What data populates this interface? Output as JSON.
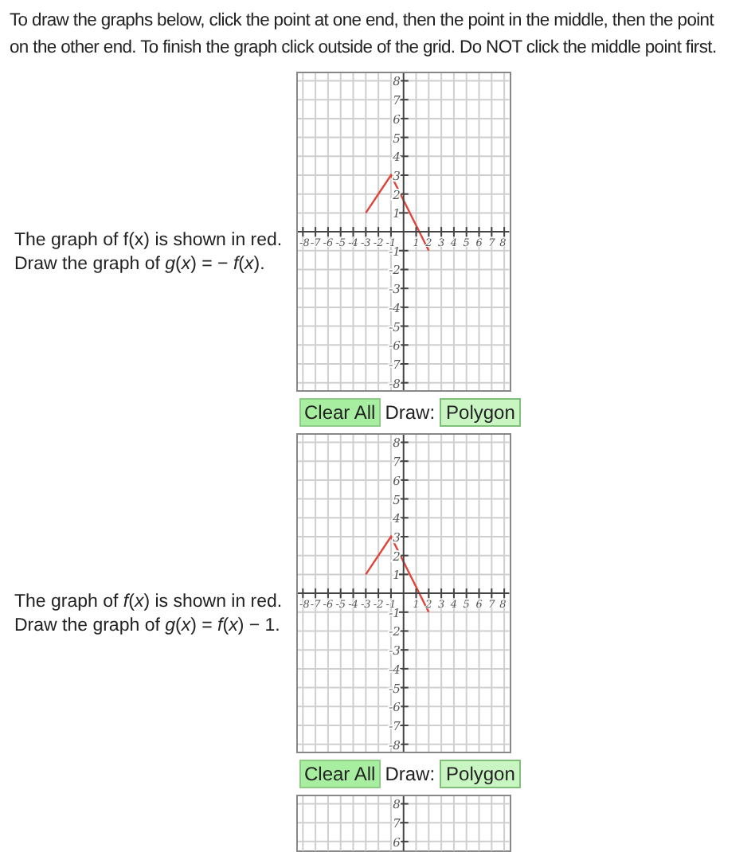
{
  "instructions": "To draw the graphs below, click the point at one end, then the point in the middle, then the point on the other end. To finish the graph click outside of the grid. Do NOT click the middle point first.",
  "problems": [
    {
      "statement": [
        "The graph of f(x) is shown in red.",
        "Draw the graph of *g*(*x*) = − *f*(*x*)."
      ],
      "chart_data": {
        "type": "line",
        "grid": true,
        "x": [
          -3,
          -1,
          2
        ],
        "series": [
          {
            "color": "#e0443a",
            "values": [
              1,
              3,
              -1
            ]
          }
        ],
        "xlim": [
          -8.4,
          8.4
        ],
        "ylim": [
          -8.4,
          8.4
        ],
        "xticks": [
          -8,
          -7,
          -6,
          -5,
          -4,
          -3,
          -2,
          -1,
          1,
          2,
          3,
          4,
          5,
          6,
          7,
          8
        ],
        "yticks": [
          -8,
          -7,
          -6,
          -5,
          -4,
          -3,
          -2,
          -1,
          1,
          2,
          3,
          4,
          5,
          6,
          7,
          8
        ]
      },
      "controls": {
        "clear": "Clear All",
        "draw_label": "Draw:",
        "draw_mode": "Polygon"
      }
    },
    {
      "statement": [
        "The graph of *f*(*x*) is shown in red.",
        "Draw the graph of *g*(*x*) = *f*(*x*) − 1."
      ],
      "chart_data": {
        "type": "line",
        "grid": true,
        "x": [
          -3,
          -1,
          2
        ],
        "series": [
          {
            "color": "#e0443a",
            "values": [
              1,
              3,
              -1
            ]
          }
        ],
        "xlim": [
          -8.4,
          8.4
        ],
        "ylim": [
          -8.4,
          8.4
        ],
        "xticks": [
          -8,
          -7,
          -6,
          -5,
          -4,
          -3,
          -2,
          -1,
          1,
          2,
          3,
          4,
          5,
          6,
          7,
          8
        ],
        "yticks": [
          -8,
          -7,
          -6,
          -5,
          -4,
          -3,
          -2,
          -1,
          1,
          2,
          3,
          4,
          5,
          6,
          7,
          8
        ]
      },
      "controls": {
        "clear": "Clear All",
        "draw_label": "Draw:",
        "draw_mode": "Polygon"
      }
    },
    {
      "chart_data": {
        "type": "line",
        "grid": true,
        "xlim": [
          -8.4,
          8.4
        ],
        "ylim": [
          5.5,
          8.4
        ],
        "yticks": [
          6,
          7,
          8
        ]
      }
    }
  ]
}
